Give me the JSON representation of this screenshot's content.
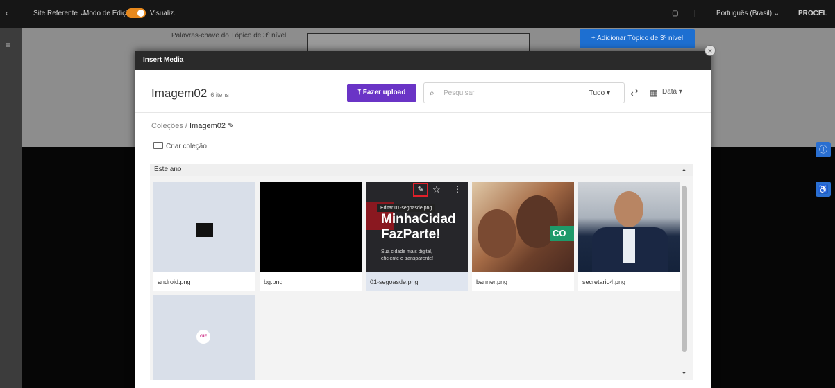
{
  "topbar": {
    "site_selector": "Site Referente ⌄",
    "mode_label": "Modo de Edição",
    "view_label": "Visualiz.",
    "language": "Português (Brasil) ⌄",
    "brand": "PROCEL"
  },
  "background": {
    "field_label": "Palavras-chave do Tópico de 3º nível",
    "add_button": "+ Adicionar Tópico de 3º nível",
    "badge_top": "ⓘ",
    "badge_bottom": "♿"
  },
  "modal": {
    "title": "Insert Media",
    "close": "×",
    "collection_title": "Imagem02",
    "collection_count": "6 itens",
    "upload_label": "⤒ Fazer upload",
    "search_icon": "search-icon",
    "search_placeholder": "Pesquisar",
    "filter_type": "Tudo ▾",
    "filter_icon": "⇄",
    "grid_icon": "▦",
    "sort_label": "Data ▾",
    "breadcrumb_root": "Coleções",
    "breadcrumb_sep": "/",
    "breadcrumb_current": "Imagem02 ✎",
    "create_collection": "Criar coleção",
    "group_header": "Este ano",
    "tooltip": "Editar 01-segoasde.png",
    "items": [
      {
        "name": "android.png",
        "thumb": "android-logo"
      },
      {
        "name": "bg.png",
        "thumb": "black"
      },
      {
        "name": "01-segoasde.png",
        "thumb": "minhacidade",
        "selected": true,
        "text1": "MinhaCidad",
        "text2": "FazParte!",
        "text3": "Sua cidade mais digital,",
        "text4": "eficiente e transparente!"
      },
      {
        "name": "banner.png",
        "thumb": "photo-family",
        "cta": "CO"
      },
      {
        "name": "secretario4.png",
        "thumb": "photo-man"
      },
      {
        "name": "",
        "thumb": "gif",
        "badge": "GIF"
      }
    ]
  },
  "colors": {
    "accent_purple": "#6a34c6",
    "accent_blue": "#1d6fd1",
    "toggle_orange": "#e8891d",
    "edit_outline": "#e0202a"
  }
}
